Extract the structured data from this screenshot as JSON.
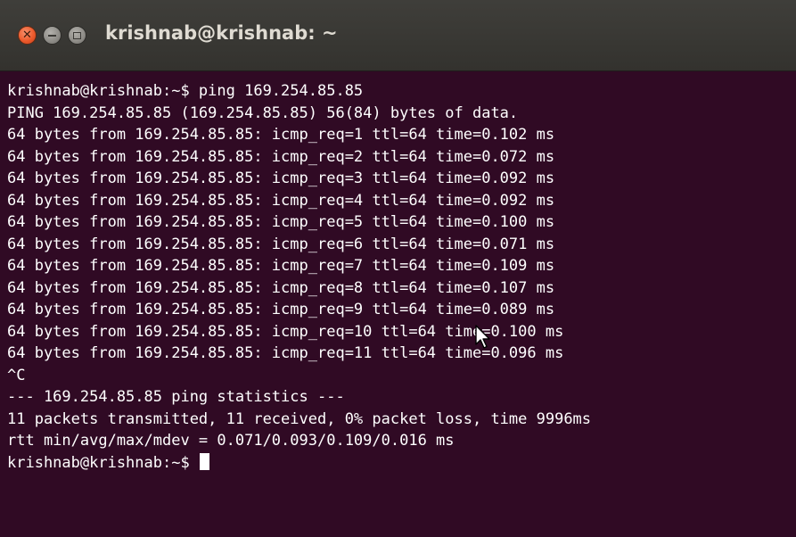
{
  "window": {
    "title": "krishnab@krishnab: ~",
    "buttons": {
      "close_icon": "close-icon",
      "minimize_icon": "minimize-icon",
      "maximize_icon": "maximize-icon"
    }
  },
  "colors": {
    "terminal_background": "#300a24",
    "titlebar": "#3c3b37",
    "close_button": "#ec5a2c",
    "text": "#ffffff"
  },
  "terminal": {
    "lines": [
      "krishnab@krishnab:~$ ping 169.254.85.85",
      "PING 169.254.85.85 (169.254.85.85) 56(84) bytes of data.",
      "64 bytes from 169.254.85.85: icmp_req=1 ttl=64 time=0.102 ms",
      "64 bytes from 169.254.85.85: icmp_req=2 ttl=64 time=0.072 ms",
      "64 bytes from 169.254.85.85: icmp_req=3 ttl=64 time=0.092 ms",
      "64 bytes from 169.254.85.85: icmp_req=4 ttl=64 time=0.092 ms",
      "64 bytes from 169.254.85.85: icmp_req=5 ttl=64 time=0.100 ms",
      "64 bytes from 169.254.85.85: icmp_req=6 ttl=64 time=0.071 ms",
      "64 bytes from 169.254.85.85: icmp_req=7 ttl=64 time=0.109 ms",
      "64 bytes from 169.254.85.85: icmp_req=8 ttl=64 time=0.107 ms",
      "64 bytes from 169.254.85.85: icmp_req=9 ttl=64 time=0.089 ms",
      "64 bytes from 169.254.85.85: icmp_req=10 ttl=64 time=0.100 ms",
      "64 bytes from 169.254.85.85: icmp_req=11 ttl=64 time=0.096 ms",
      "^C",
      "--- 169.254.85.85 ping statistics ---",
      "11 packets transmitted, 11 received, 0% packet loss, time 9996ms",
      "rtt min/avg/max/mdev = 0.071/0.093/0.109/0.016 ms"
    ],
    "prompt": "krishnab@krishnab:~$ "
  }
}
